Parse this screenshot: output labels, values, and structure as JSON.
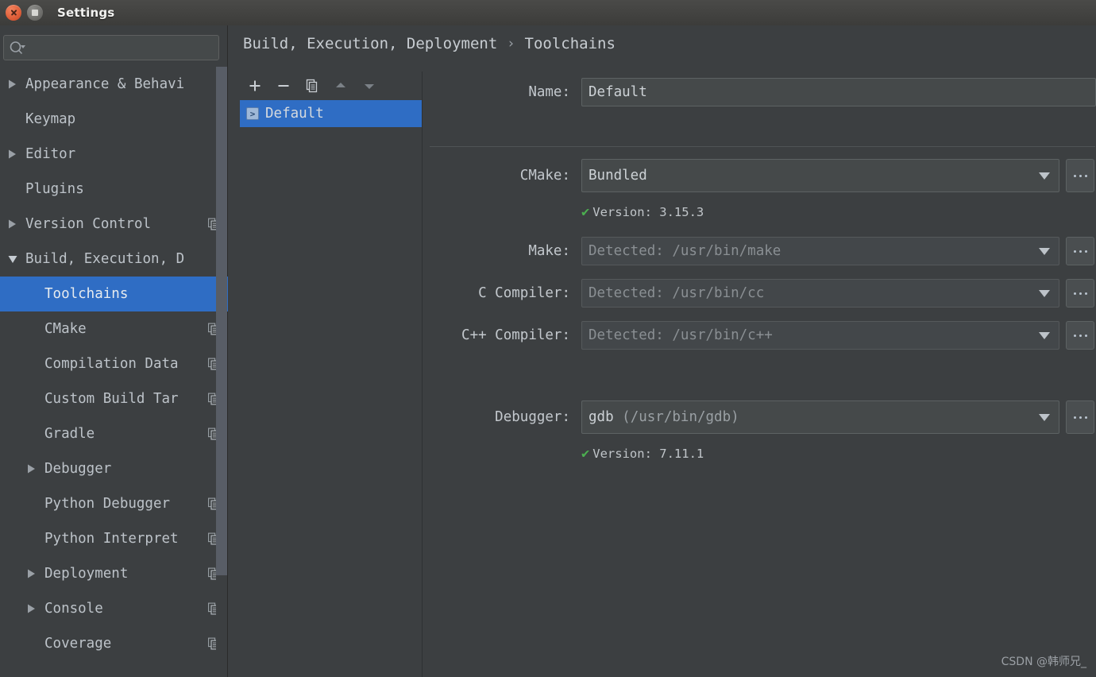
{
  "window": {
    "title": "Settings",
    "close_icon": "close-icon",
    "maximize_icon": "maximize-icon"
  },
  "search": {
    "placeholder": "",
    "value": "",
    "icon": "search-icon"
  },
  "sidebar": {
    "items": [
      {
        "label": "Appearance & Behavi",
        "depth": 0,
        "arrow": "collapsed",
        "copy": false,
        "selected": false
      },
      {
        "label": "Keymap",
        "depth": 0,
        "arrow": "none",
        "copy": false,
        "selected": false
      },
      {
        "label": "Editor",
        "depth": 0,
        "arrow": "collapsed",
        "copy": false,
        "selected": false
      },
      {
        "label": "Plugins",
        "depth": 0,
        "arrow": "none",
        "copy": false,
        "selected": false
      },
      {
        "label": "Version Control",
        "depth": 0,
        "arrow": "collapsed",
        "copy": true,
        "selected": false
      },
      {
        "label": "Build, Execution, D",
        "depth": 0,
        "arrow": "expanded",
        "copy": false,
        "selected": false
      },
      {
        "label": "Toolchains",
        "depth": 1,
        "arrow": "none",
        "copy": false,
        "selected": true
      },
      {
        "label": "CMake",
        "depth": 1,
        "arrow": "none",
        "copy": true,
        "selected": false
      },
      {
        "label": "Compilation Data",
        "depth": 1,
        "arrow": "none",
        "copy": true,
        "selected": false
      },
      {
        "label": "Custom Build Tar",
        "depth": 1,
        "arrow": "none",
        "copy": true,
        "selected": false
      },
      {
        "label": "Gradle",
        "depth": 1,
        "arrow": "none",
        "copy": true,
        "selected": false
      },
      {
        "label": "Debugger",
        "depth": 1,
        "arrow": "collapsed",
        "copy": false,
        "selected": false
      },
      {
        "label": "Python Debugger",
        "depth": 1,
        "arrow": "none",
        "copy": true,
        "selected": false
      },
      {
        "label": "Python Interpret",
        "depth": 1,
        "arrow": "none",
        "copy": true,
        "selected": false
      },
      {
        "label": "Deployment",
        "depth": 1,
        "arrow": "collapsed",
        "copy": true,
        "selected": false
      },
      {
        "label": "Console",
        "depth": 1,
        "arrow": "collapsed",
        "copy": true,
        "selected": false
      },
      {
        "label": "Coverage",
        "depth": 1,
        "arrow": "none",
        "copy": true,
        "selected": false
      }
    ]
  },
  "breadcrumb": {
    "parent": "Build, Execution, Deployment",
    "separator": "›",
    "current": "Toolchains"
  },
  "toolbar": {
    "add_label": "+",
    "remove_label": "−",
    "copy_icon": "copy-icon",
    "move_up_icon": "arrow-up-icon",
    "move_down_icon": "arrow-down-icon"
  },
  "toolchain_list": {
    "items": [
      {
        "name": "Default",
        "icon": "toolchain-icon",
        "selected": true
      }
    ]
  },
  "form": {
    "name": {
      "label": "Name:",
      "value": "Default"
    },
    "cmake": {
      "label": "CMake:",
      "value": "Bundled",
      "browse_label": "...",
      "version": "Version: 3.15.3",
      "version_ok": true
    },
    "make": {
      "label": "Make:",
      "value": "Detected: /usr/bin/make",
      "disabled": true,
      "browse_label": "..."
    },
    "c_compiler": {
      "label": "C Compiler:",
      "value": "Detected: /usr/bin/cc",
      "disabled": true,
      "browse_label": "..."
    },
    "cpp_compiler": {
      "label": "C++ Compiler:",
      "value": "Detected: /usr/bin/c++",
      "disabled": true,
      "browse_label": "..."
    },
    "debugger": {
      "label": "Debugger:",
      "value_name": "gdb",
      "value_path": "(/usr/bin/gdb)",
      "browse_label": "...",
      "version": "Version: 7.11.1",
      "version_ok": true
    }
  },
  "watermark": "CSDN @韩师兄_",
  "colors": {
    "accent": "#2f6dc4",
    "background": "#3c3f41",
    "field": "#45494a",
    "text": "#c3c8cd",
    "ok_green": "#4caf50",
    "titlebar_close": "#e0603a"
  }
}
